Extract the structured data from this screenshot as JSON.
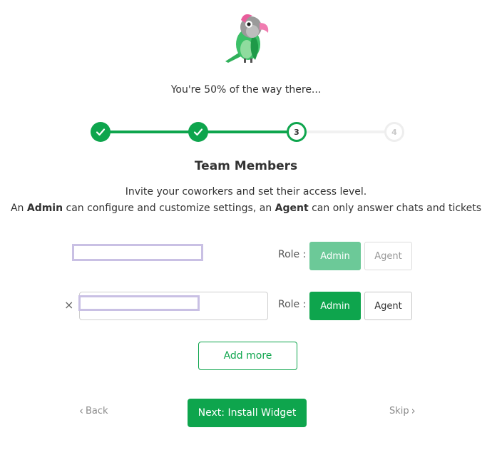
{
  "progress_text": "You're 50% of the way there...",
  "steps": [
    {
      "label": "",
      "state": "done"
    },
    {
      "label": "",
      "state": "done"
    },
    {
      "label": "3",
      "state": "current"
    },
    {
      "label": "4",
      "state": "todo"
    }
  ],
  "section_title": "Team Members",
  "description": {
    "line1": "Invite your coworkers and set their access level.",
    "line2_prefix": "An ",
    "line2_admin": "Admin",
    "line2_middle": " can configure and customize settings, an ",
    "line2_agent": "Agent",
    "line2_suffix": " can only answer chats and tickets"
  },
  "members": [
    {
      "email": "",
      "role_label": "Role :",
      "admin_label": "Admin",
      "agent_label": "Agent",
      "selected_role": "Admin",
      "removable": false
    },
    {
      "email": "",
      "role_label": "Role :",
      "admin_label": "Admin",
      "agent_label": "Agent",
      "selected_role": "Admin",
      "removable": true,
      "remove_icon": "×"
    }
  ],
  "add_more_label": "Add more",
  "nav": {
    "back_label": "Back",
    "back_icon": "‹",
    "next_label": "Next: Install Widget",
    "skip_label": "Skip",
    "skip_icon": "›"
  },
  "colors": {
    "primary": "#0ea54d",
    "primary_light": "#6cc998",
    "redaction": "#c9c0e4"
  }
}
